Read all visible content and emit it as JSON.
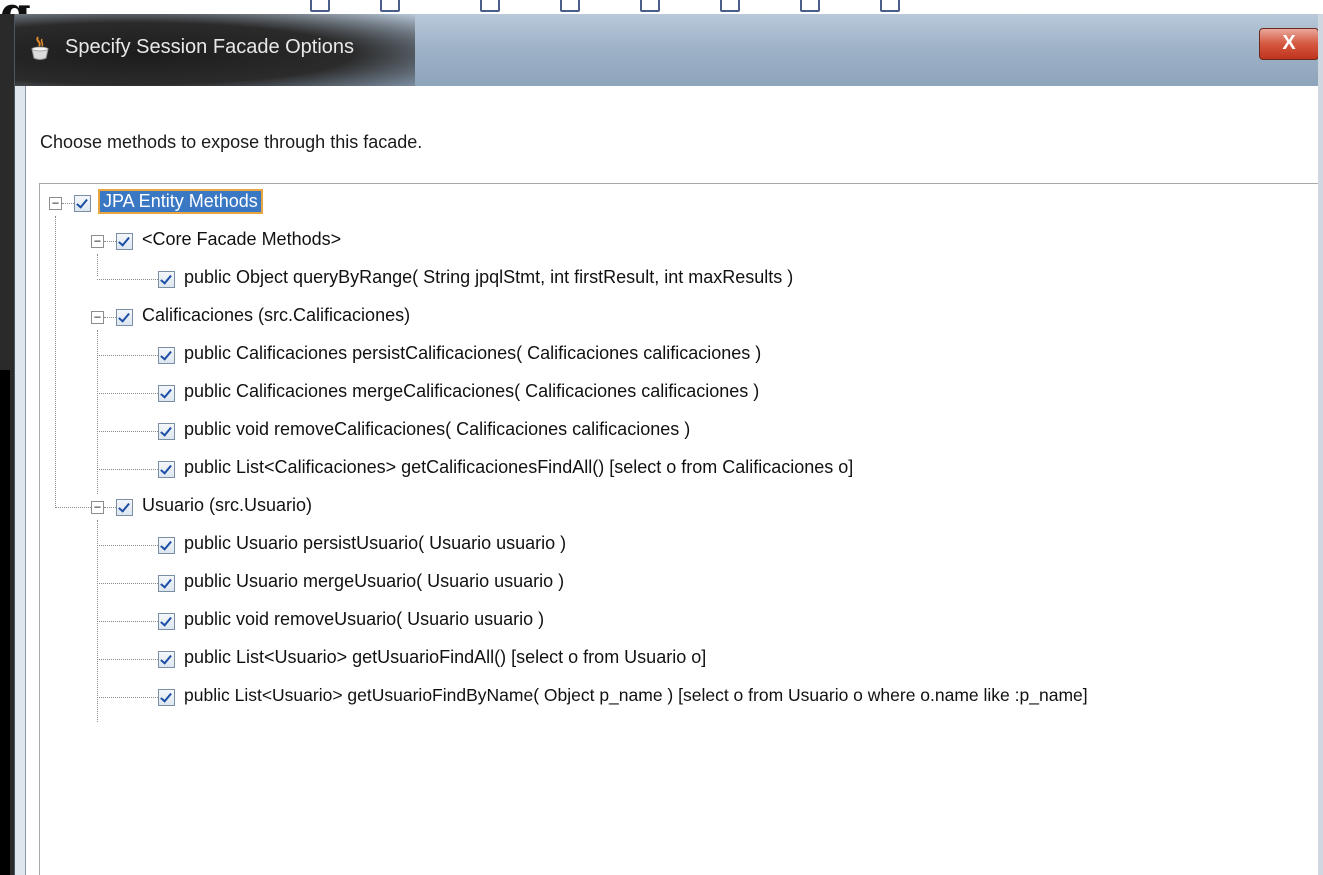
{
  "dialog": {
    "title": "Specify Session Facade Options",
    "close_label": "X",
    "instruction": "Choose methods to expose through this facade."
  },
  "tree": {
    "root": {
      "label": "JPA Entity Methods",
      "checked": true,
      "expanded": true,
      "selected": true
    },
    "groups": [
      {
        "label": "<Core Facade Methods>",
        "checked": true,
        "expanded": true,
        "methods": [
          {
            "label": "public Object queryByRange( String jpqlStmt, int firstResult, int maxResults )",
            "checked": true
          }
        ]
      },
      {
        "label": "Calificaciones (src.Calificaciones)",
        "checked": true,
        "expanded": true,
        "methods": [
          {
            "label": "public Calificaciones persistCalificaciones( Calificaciones calificaciones )",
            "checked": true
          },
          {
            "label": "public Calificaciones mergeCalificaciones( Calificaciones calificaciones )",
            "checked": true
          },
          {
            "label": "public void removeCalificaciones( Calificaciones calificaciones )",
            "checked": true
          },
          {
            "label": "public List<Calificaciones> getCalificacionesFindAll() [select o from Calificaciones o]",
            "checked": true
          }
        ]
      },
      {
        "label": "Usuario (src.Usuario)",
        "checked": true,
        "expanded": true,
        "methods": [
          {
            "label": "public Usuario persistUsuario( Usuario usuario )",
            "checked": true
          },
          {
            "label": "public Usuario mergeUsuario( Usuario usuario )",
            "checked": true
          },
          {
            "label": "public void removeUsuario( Usuario usuario )",
            "checked": true
          },
          {
            "label": "public List<Usuario> getUsuarioFindAll() [select o from Usuario o]",
            "checked": true
          },
          {
            "label": "public List<Usuario> getUsuarioFindByName( Object p_name ) [select o from Usuario o where o.name like :p_name]",
            "checked": true
          }
        ]
      }
    ]
  },
  "colors": {
    "selection": "#3a78c4",
    "selection_outline": "#e9a640",
    "close_button": "#c9442c",
    "checkmark": "#1c4fa5"
  }
}
